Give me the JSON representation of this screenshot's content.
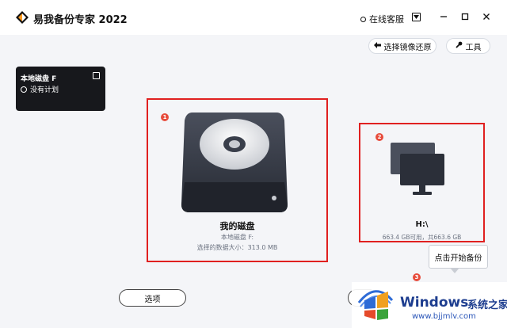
{
  "app": {
    "title": "易我备份专家 2022"
  },
  "titlebar": {
    "support_label": "在线客服"
  },
  "toolbar": {
    "restore_label": "选择镜像还原",
    "tools_label": "工具"
  },
  "task": {
    "name": "本地磁盘 F",
    "schedule": "没有计划"
  },
  "source": {
    "badge": "1",
    "title": "我的磁盘",
    "subtitle": "本地磁盘 F:",
    "size_text": "选择的数据大小：313.0 MB"
  },
  "target": {
    "badge": "2",
    "title": "H:\\",
    "space_text": "663.4 GB可用，共663.6 GB"
  },
  "hint": {
    "badge": "3",
    "tooltip": "点击开始备份"
  },
  "bottom": {
    "options_label": "选项"
  },
  "watermark": {
    "brand": "Windows",
    "brand_cn": "系统之家",
    "url": "www.bjjmlv.com"
  },
  "colors": {
    "highlight": "#e02020",
    "badge": "#e74c3c",
    "card_bg": "#17181c",
    "watermark": "#1d3d8f"
  },
  "icons": [
    "app-logo-icon",
    "support-icon",
    "menu-icon",
    "minimize-icon",
    "maximize-icon",
    "close-icon",
    "back-arrow-icon",
    "wrench-icon",
    "edit-icon",
    "clock-icon",
    "hard-disk-icon",
    "computer-icon",
    "windows-logo-icon"
  ]
}
